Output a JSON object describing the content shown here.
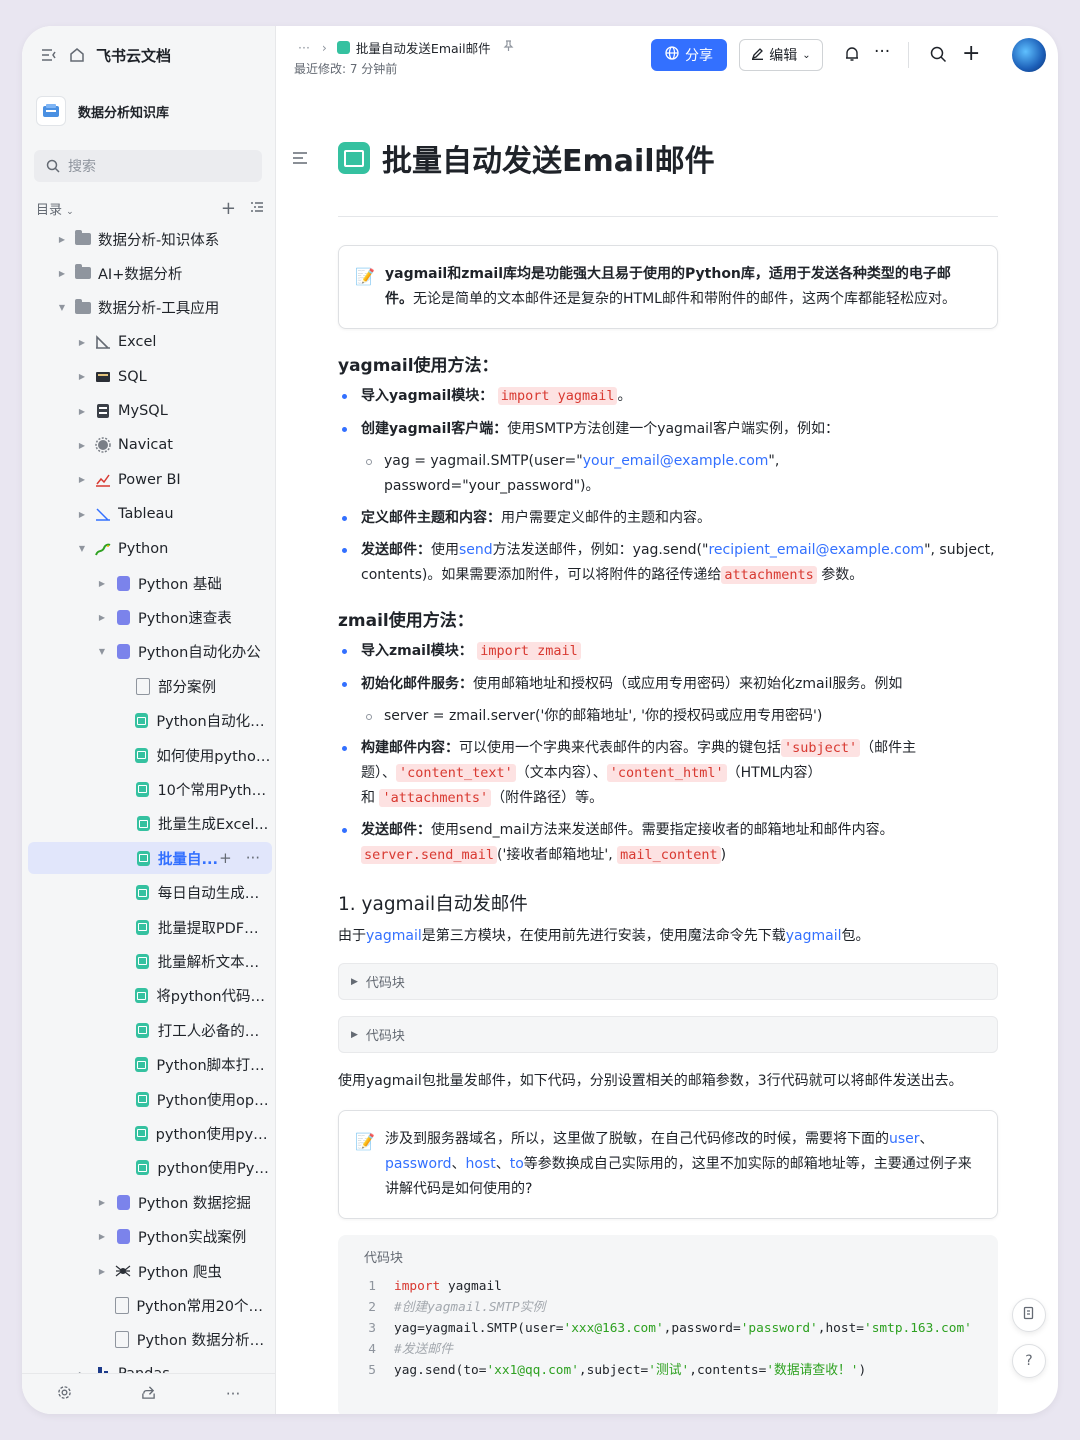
{
  "app": {
    "title": "飞书云文档"
  },
  "space": {
    "name": "数据分析知识库"
  },
  "search": {
    "placeholder": "搜索"
  },
  "toc": {
    "label": "目录"
  },
  "tree": [
    {
      "label": "数据分析-知识体系",
      "level": 0,
      "icon": "folder",
      "arrow": "right"
    },
    {
      "label": "AI+数据分析",
      "level": 0,
      "icon": "folder",
      "arrow": "right"
    },
    {
      "label": "数据分析-工具应用",
      "level": 0,
      "icon": "folder",
      "arrow": "down"
    },
    {
      "label": "Excel",
      "level": 1,
      "icon": "excel",
      "arrow": "right"
    },
    {
      "label": "SQL",
      "level": 1,
      "icon": "sql",
      "arrow": "right"
    },
    {
      "label": "MySQL",
      "level": 1,
      "icon": "mysql",
      "arrow": "right"
    },
    {
      "label": "Navicat",
      "level": 1,
      "icon": "navicat",
      "arrow": "right"
    },
    {
      "label": "Power BI",
      "level": 1,
      "icon": "powerbi",
      "arrow": "right"
    },
    {
      "label": "Tableau",
      "level": 1,
      "icon": "tableau",
      "arrow": "right"
    },
    {
      "label": "Python",
      "level": 1,
      "icon": "python",
      "arrow": "down"
    },
    {
      "label": "Python 基础",
      "level": 2,
      "icon": "doc-purple",
      "arrow": "right"
    },
    {
      "label": "Python速查表",
      "level": 2,
      "icon": "doc-purple",
      "arrow": "right"
    },
    {
      "label": "Python自动化办公",
      "level": 2,
      "icon": "doc-purple",
      "arrow": "down"
    },
    {
      "label": "部分案例",
      "level": 3,
      "icon": "doc-gray",
      "arrow": ""
    },
    {
      "label": "Python自动化办...",
      "level": 3,
      "icon": "doc-green",
      "arrow": ""
    },
    {
      "label": "如何使用python...",
      "level": 3,
      "icon": "doc-green",
      "arrow": ""
    },
    {
      "label": "10个常用Pytho...",
      "level": 3,
      "icon": "doc-green",
      "arrow": ""
    },
    {
      "label": "批量生成Excel...",
      "level": 3,
      "icon": "doc-green",
      "arrow": ""
    },
    {
      "label": "批量自...",
      "level": 3,
      "icon": "doc-green",
      "arrow": "",
      "active": true
    },
    {
      "label": "每日自动生成数...",
      "level": 3,
      "icon": "doc-green",
      "arrow": ""
    },
    {
      "label": "批量提取PDF数...",
      "level": 3,
      "icon": "doc-green",
      "arrow": ""
    },
    {
      "label": "批量解析文本数据",
      "level": 3,
      "icon": "doc-green",
      "arrow": ""
    },
    {
      "label": "将python代码打...",
      "level": 3,
      "icon": "doc-green",
      "arrow": ""
    },
    {
      "label": "打工人必备的十...",
      "level": 3,
      "icon": "doc-green",
      "arrow": ""
    },
    {
      "label": "Python脚本打包...",
      "level": 3,
      "icon": "doc-green",
      "arrow": ""
    },
    {
      "label": "Python使用ope...",
      "level": 3,
      "icon": "doc-green",
      "arrow": ""
    },
    {
      "label": "python使用pyth...",
      "level": 3,
      "icon": "doc-green",
      "arrow": ""
    },
    {
      "label": "python使用PyP...",
      "level": 3,
      "icon": "doc-green",
      "arrow": ""
    },
    {
      "label": "Python 数据挖掘",
      "level": 2,
      "icon": "doc-purple",
      "arrow": "right"
    },
    {
      "label": "Python实战案例",
      "level": 2,
      "icon": "doc-purple",
      "arrow": "right"
    },
    {
      "label": "Python 爬虫",
      "level": 2,
      "icon": "spider",
      "arrow": "right"
    },
    {
      "label": "Python常用20个Ex...",
      "level": 2,
      "icon": "doc-gray",
      "arrow": ""
    },
    {
      "label": "Python 数据分析与...",
      "level": 2,
      "icon": "doc-gray",
      "arrow": ""
    },
    {
      "label": "Pandas",
      "level": 1,
      "icon": "pandas",
      "arrow": "right"
    }
  ],
  "topbar": {
    "breadcrumb_ellipsis": "···",
    "doc_title": "批量自动发送Email邮件",
    "modified": "最近修改: 7 分钟前",
    "share_label": "分享",
    "edit_label": "编辑"
  },
  "doc": {
    "title": "批量自动发送Email邮件",
    "callout1": {
      "bold": "yagmail和zmail库均是功能强大且易于使用的Python库，适用于发送各种类型的电子邮件。",
      "rest": "无论是简单的文本邮件还是复杂的HTML邮件和带附件的邮件，这两个库都能轻松应对。"
    },
    "yag_heading": "yagmail使用方法：",
    "yag1_b": "导入yagmail模块：",
    "yag1_code": "import yagmail",
    "yag1_end": "。",
    "yag2_b": "创建yagmail客户端：",
    "yag2_t": "使用SMTP方法创建一个yagmail客户端实例，例如：",
    "yag2_sub_a": "yag = yagmail.SMTP(user=\"",
    "yag2_sub_link": "your_email@example.com",
    "yag2_sub_b": "\", password=\"your_password\")。",
    "yag3_b": "定义邮件主题和内容：",
    "yag3_t": "用户需要定义邮件的主题和内容。",
    "yag4_b": "发送邮件：",
    "yag4_t1": "使用",
    "yag4_send": "send",
    "yag4_t2": "方法发送邮件，例如：yag.send(\"",
    "yag4_link": "recipient_email@example.com",
    "yag4_t3": "\", subject, contents)。如果需要添加附件，可以将附件的路径传递给",
    "yag4_code": "attachments",
    "yag4_t4": "参数。",
    "zmail_heading": "zmail使用方法：",
    "z1_b": "导入zmail模块：",
    "z1_code": "import zmail",
    "z2_b": "初始化邮件服务：",
    "z2_t": "使用邮箱地址和授权码（或应用专用密码）来初始化zmail服务。例如",
    "z2_sub": "server = zmail.server('你的邮箱地址', '你的授权码或应用专用密码')",
    "z3_b": "构建邮件内容：",
    "z3_t1": "可以使用一个字典来代表邮件的内容。字典的键包括",
    "z3_c1": "'subject'",
    "z3_t2": "（邮件主题）、",
    "z3_c2": "'content_text'",
    "z3_t3": "（文本内容）、",
    "z3_c3": "'content_html'",
    "z3_t4": "（HTML内容）",
    "z3_t5": "和",
    "z3_c4": "'attachments'",
    "z3_t6": "（附件路径）等。",
    "z4_b": "发送邮件：",
    "z4_t": "使用send_mail方法来发送邮件。需要指定接收者的邮箱地址和邮件内容。",
    "z4_c1": "server.send_mail",
    "z4_t2": "('接收者邮箱地址',",
    "z4_c2": "mail_content",
    "z4_t3": ")",
    "sec1_heading": "1. yagmail自动发邮件",
    "sec1_p_a": "由于",
    "sec1_p_link1": "yagmail",
    "sec1_p_b": "是第三方模块，在使用前先进行安装，使用魔法命令先下载",
    "sec1_p_link2": "yagmail",
    "sec1_p_c": "包。",
    "fold1": "代码块",
    "fold2": "代码块",
    "p2": "使用yagmail包批量发邮件，如下代码，分别设置相关的邮箱参数，3行代码就可以将邮件发送出去。",
    "callout2": {
      "a": "涉及到服务器域名，所以，这里做了脱敏，在自己代码修改的时候，需要将下面的",
      "l1": "user",
      "s1": "、",
      "l2": "password",
      "s2": "、",
      "l3": "host",
      "s3": "、",
      "l4": "to",
      "b": "等参数换成自己实际用的，这里不加实际的邮箱地址等，主要通过例子来讲解代码是如何使用的?"
    },
    "codeblock_label": "代码块",
    "code_lines": [
      "1",
      "2",
      "3",
      "4",
      "5"
    ]
  }
}
